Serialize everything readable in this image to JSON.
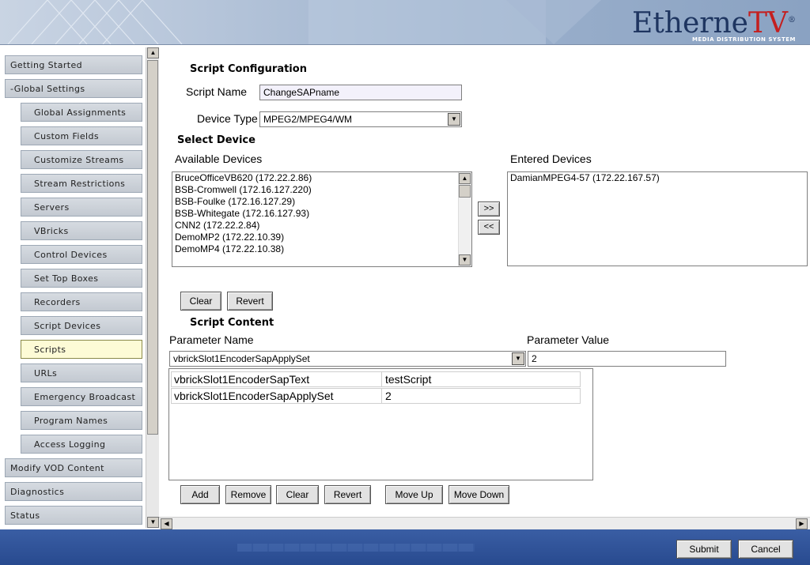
{
  "brand": {
    "name_main": "Etherne",
    "name_accent": "TV",
    "registered": "®",
    "tagline": "MEDIA DISTRIBUTION SYSTEM"
  },
  "sidebar": {
    "items": [
      {
        "label": "Getting Started",
        "level": 0
      },
      {
        "label": "-Global Settings",
        "level": 0
      },
      {
        "label": "Global Assignments",
        "level": 1
      },
      {
        "label": "Custom Fields",
        "level": 1
      },
      {
        "label": "Customize Streams",
        "level": 1
      },
      {
        "label": "Stream Restrictions",
        "level": 1
      },
      {
        "label": "Servers",
        "level": 1
      },
      {
        "label": "VBricks",
        "level": 1
      },
      {
        "label": "Control Devices",
        "level": 1
      },
      {
        "label": "Set Top Boxes",
        "level": 1
      },
      {
        "label": "Recorders",
        "level": 1
      },
      {
        "label": "Script Devices",
        "level": 1
      },
      {
        "label": "Scripts",
        "level": 1,
        "active": true
      },
      {
        "label": "URLs",
        "level": 1
      },
      {
        "label": "Emergency Broadcast",
        "level": 1
      },
      {
        "label": "Program Names",
        "level": 1
      },
      {
        "label": "Access Logging",
        "level": 1
      },
      {
        "label": "Modify VOD Content",
        "level": 0
      },
      {
        "label": "Diagnostics",
        "level": 0
      },
      {
        "label": "Status",
        "level": 0
      }
    ]
  },
  "config": {
    "title": "Script Configuration",
    "script_name_label": "Script Name",
    "script_name_value": "ChangeSAPname",
    "device_type_label": "Device Type",
    "device_type_value": "MPEG2/MPEG4/WM"
  },
  "select_device": {
    "title": "Select Device",
    "available_label": "Available Devices",
    "entered_label": "Entered Devices",
    "available": [
      "BruceOfficeVB620 (172.22.2.86)",
      "BSB-Cromwell (172.16.127.220)",
      "BSB-Foulke (172.16.127.29)",
      "BSB-Whitegate (172.16.127.93)",
      "CNN2 (172.22.2.84)",
      "DemoMP2 (172.22.10.39)",
      "DemoMP4 (172.22.10.38)"
    ],
    "entered": [
      "DamianMPEG4-57 (172.22.167.57)"
    ],
    "add_label": ">>",
    "remove_label": "<<",
    "clear_label": "Clear",
    "revert_label": "Revert"
  },
  "script_content": {
    "title": "Script Content",
    "param_name_label": "Parameter Name",
    "param_value_label": "Parameter Value",
    "param_name_value": "vbrickSlot1EncoderSapApplySet",
    "param_value_value": "2",
    "rows": [
      {
        "name": "vbrickSlot1EncoderSapText",
        "value": "testScript"
      },
      {
        "name": "vbrickSlot1EncoderSapApplySet",
        "value": "2"
      }
    ],
    "buttons": {
      "add": "Add",
      "remove": "Remove",
      "clear": "Clear",
      "revert": "Revert",
      "move_up": "Move Up",
      "move_down": "Move Down"
    }
  },
  "footer": {
    "submit": "Submit",
    "cancel": "Cancel"
  },
  "colors": {
    "header": "#9bb0cc",
    "footer": "#2f5296",
    "logo_blue": "#1e3560",
    "logo_red": "#c41f1f",
    "active_item": "#fdfbd6"
  }
}
